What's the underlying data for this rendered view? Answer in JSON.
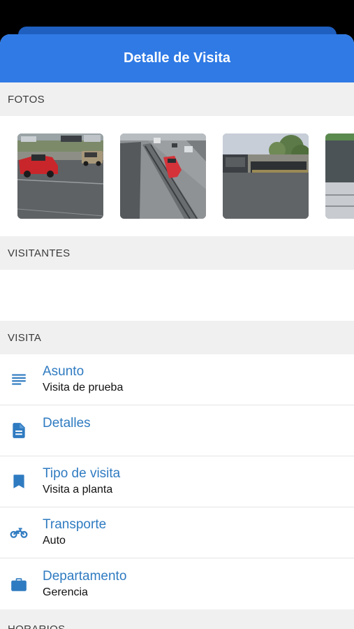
{
  "header": {
    "title": "Detalle de Visita"
  },
  "sections": {
    "fotos": "FOTOS",
    "visitantes": "VISITANTES",
    "visita": "VISITA",
    "horarios": "HORARIOS"
  },
  "photos": [
    {
      "name": "photo-1",
      "description": "red pickup truck in parking lot"
    },
    {
      "name": "photo-2",
      "description": "red car on road viewed from above"
    },
    {
      "name": "photo-3",
      "description": "truck and parked cars in yard"
    },
    {
      "name": "photo-4",
      "description": "partially visible building"
    }
  ],
  "visita": {
    "asunto": {
      "label": "Asunto",
      "value": "Visita de prueba",
      "icon": "subject-lines-icon"
    },
    "detalles": {
      "label": "Detalles",
      "value": "",
      "icon": "document-icon"
    },
    "tipo": {
      "label": "Tipo de visita",
      "value": "Visita a planta",
      "icon": "bookmark-icon"
    },
    "transporte": {
      "label": "Transporte",
      "value": "Auto",
      "icon": "motorcycle-icon"
    },
    "departamento": {
      "label": "Departamento",
      "value": "Gerencia",
      "icon": "briefcase-icon"
    }
  },
  "colors": {
    "header": "#2f7ae5",
    "accent": "#2f7bc1",
    "section_bg": "#f0f0f0"
  }
}
